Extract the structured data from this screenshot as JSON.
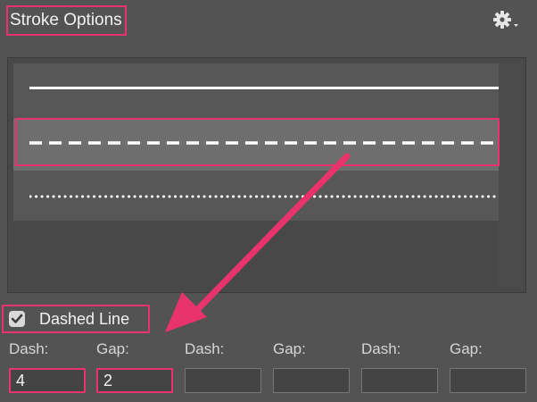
{
  "panel": {
    "title": "Stroke Options"
  },
  "header": {
    "settings_icon": "gear-icon",
    "dropdown_icon": "chevron-down-icon"
  },
  "stroke_presets": [
    {
      "style": "solid",
      "selected": false
    },
    {
      "style": "dashed",
      "selected": true
    },
    {
      "style": "dotted",
      "selected": false
    }
  ],
  "dashed_line": {
    "label": "Dashed Line",
    "checked": true
  },
  "dash_fields": [
    {
      "dash_label": "Dash:",
      "gap_label": "Gap:",
      "dash_value": "4",
      "gap_value": "2"
    },
    {
      "dash_label": "Dash:",
      "gap_label": "Gap:",
      "dash_value": "",
      "gap_value": ""
    },
    {
      "dash_label": "Dash:",
      "gap_label": "Gap:",
      "dash_value": "",
      "gap_value": ""
    }
  ],
  "colors": {
    "annotation": "#e8336d",
    "panel_bg": "#535353",
    "selected_row": "#6e6e6e",
    "stroke": "#ffffff"
  }
}
